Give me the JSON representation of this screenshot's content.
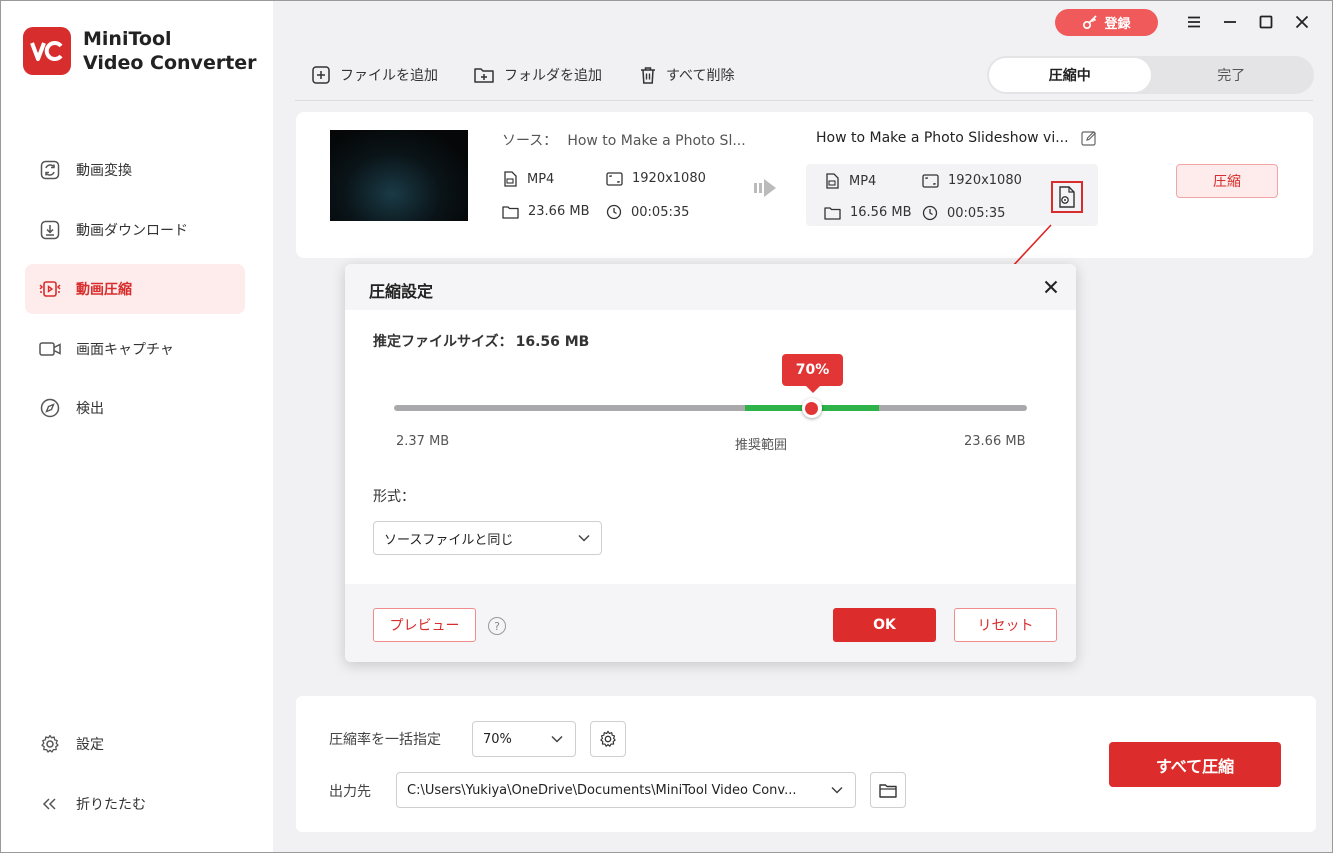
{
  "app": {
    "name_line1": "MiniTool",
    "name_line2": "Video Converter",
    "logo_text": "VC",
    "brand_color": "#d82d2d"
  },
  "titlebar": {
    "register_label": "登録"
  },
  "sidebar": {
    "items": [
      {
        "label": "動画変換",
        "icon": "convert-icon",
        "active": false
      },
      {
        "label": "動画ダウンロード",
        "icon": "download-icon",
        "active": false
      },
      {
        "label": "動画圧縮",
        "icon": "compress-icon",
        "active": true
      },
      {
        "label": "画面キャプチャ",
        "icon": "camera-icon",
        "active": false
      },
      {
        "label": "検出",
        "icon": "compass-icon",
        "active": false
      }
    ],
    "bottom_items": [
      {
        "label": "設定",
        "icon": "gear-icon"
      },
      {
        "label": "折りたたむ",
        "icon": "collapse-icon"
      }
    ]
  },
  "toolbar": {
    "add_file": "ファイルを追加",
    "add_folder": "フォルダを追加",
    "delete_all": "すべて削除",
    "tabs": [
      {
        "label": "圧縮中",
        "active": true
      },
      {
        "label": "完了",
        "active": false
      }
    ]
  },
  "file": {
    "source_label": "ソース：",
    "source_name": "How to Make a Photo Sl...",
    "source_format": "MP4",
    "source_resolution": "1920x1080",
    "source_size": "23.66 MB",
    "source_duration": "00:05:35",
    "output_name": "How to Make a Photo Slideshow vi...",
    "output_format": "MP4",
    "output_resolution": "1920x1080",
    "output_size": "16.56 MB",
    "output_duration": "00:05:35",
    "compress_label": "圧縮"
  },
  "dialog": {
    "title": "圧縮設定",
    "estimated_label": "推定ファイルサイズ：",
    "estimated_value": "16.56 MB",
    "slider_value": "70%",
    "slider_fraction": 0.66,
    "slider_min": "2.37 MB",
    "slider_recommended": "推奨範囲",
    "slider_max": "23.66 MB",
    "format_label": "形式：",
    "format_value": "ソースファイルと同じ",
    "preview_label": "プレビュー",
    "help_label": "?",
    "ok_label": "OK",
    "reset_label": "リセット"
  },
  "bottom": {
    "ratio_label": "圧縮率を一括指定",
    "ratio_value": "70%",
    "output_label": "出力先",
    "output_path": "C:\\Users\\Yukiya\\OneDrive\\Documents\\MiniTool Video Conv...",
    "compress_all_label": "すべて圧縮"
  }
}
